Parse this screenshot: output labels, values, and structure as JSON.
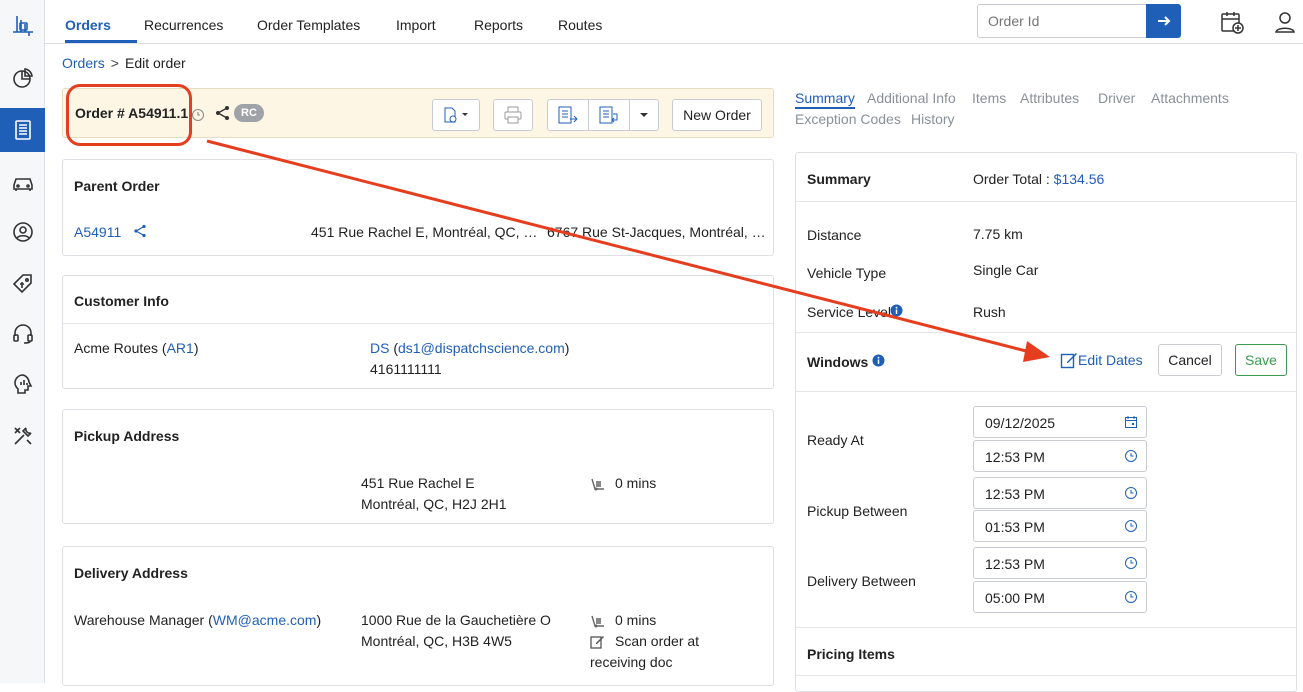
{
  "nav": {
    "tabs": [
      "Orders",
      "Recurrences",
      "Order Templates",
      "Import",
      "Reports",
      "Routes"
    ],
    "active_tab": "Orders",
    "order_id_placeholder": "Order Id"
  },
  "rail": {
    "items": [
      "logo-icon",
      "dashboard-icon",
      "orders-icon",
      "vehicles-icon",
      "customers-icon",
      "pricing-icon",
      "support-icon",
      "analytics-icon",
      "settings-icon"
    ],
    "active": "orders-icon"
  },
  "breadcrumb": {
    "root": "Orders",
    "separator": ">",
    "current": "Edit order"
  },
  "order": {
    "title": "Order # A54911.1",
    "badge": "RC",
    "new_order_label": "New Order"
  },
  "parent_order": {
    "title": "Parent Order",
    "id": "A54911",
    "pickup": "451 Rue Rachel E, Montréal, QC, …",
    "delivery": "6767 Rue St-Jacques, Montréal, …"
  },
  "customer_info": {
    "title": "Customer Info",
    "customer_name": "Acme Routes (",
    "customer_code": "AR1",
    "customer_close": ")",
    "contact_name": "DS",
    "contact_open": " (",
    "contact_email": "ds1@dispatchscience.com",
    "contact_close": ")",
    "phone": "4161111111"
  },
  "pickup_address": {
    "title": "Pickup Address",
    "line1": "451 Rue Rachel E",
    "line2": "Montréal, QC, H2J 2H1",
    "wait": "0 mins"
  },
  "delivery_address": {
    "title": "Delivery Address",
    "contact_name": "Warehouse Manager (",
    "contact_email": "WM@acme.com",
    "contact_close": ")",
    "line1": "1000 Rue de la Gauchetière O",
    "line2": "Montréal, QC, H3B 4W5",
    "wait": "0 mins",
    "instruction_line1": "Scan order at",
    "instruction_line2": "receiving doc"
  },
  "right_tabs": [
    "Summary",
    "Additional Info",
    "Items",
    "Attributes",
    "Driver",
    "Attachments",
    "Exception Codes",
    "History"
  ],
  "summary": {
    "title": "Summary",
    "order_total_label": "Order Total : ",
    "order_total_value": "$134.56",
    "distance_label": "Distance",
    "distance_value": "7.75 km",
    "vehicle_type_label": "Vehicle Type",
    "vehicle_type_value": "Single Car",
    "service_level_label": "Service Level",
    "service_level_value": "Rush"
  },
  "windows": {
    "title": "Windows",
    "edit_dates_label": "Edit Dates",
    "cancel_label": "Cancel",
    "save_label": "Save",
    "ready_at_label": "Ready At",
    "ready_at_date": "09/12/2025",
    "ready_at_time": "12:53 PM",
    "pickup_between_label": "Pickup Between",
    "pickup_from": "12:53 PM",
    "pickup_to": "01:53 PM",
    "delivery_between_label": "Delivery Between",
    "delivery_from": "12:53 PM",
    "delivery_to": "05:00 PM"
  },
  "pricing": {
    "title": "Pricing Items"
  },
  "colors": {
    "accent": "#1f5fb8",
    "annotation": "#e53e1f",
    "save_green": "#3a9a4f",
    "header_bg": "#fdf6e5"
  }
}
